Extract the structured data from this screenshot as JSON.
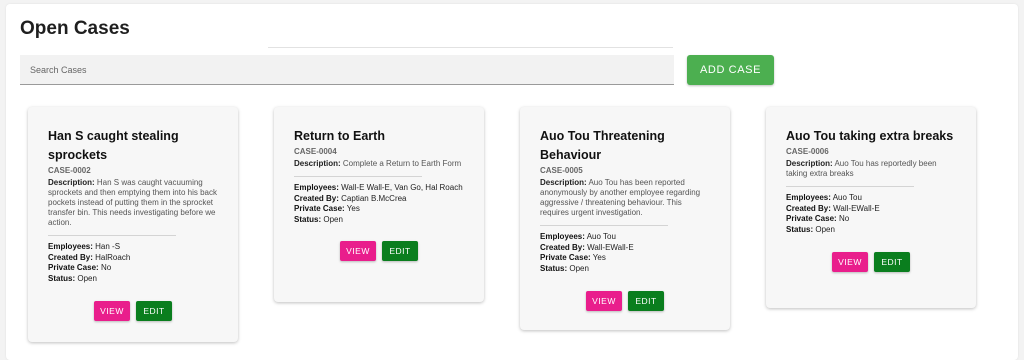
{
  "page": {
    "title": "Open Cases"
  },
  "search": {
    "placeholder": "Search Cases",
    "value": ""
  },
  "add_case_label": "ADD CASE",
  "labels": {
    "description": "Description:",
    "employees": "Employees:",
    "created_by": "Created By:",
    "private_case": "Private Case:",
    "status": "Status:"
  },
  "cases": [
    {
      "title": "Han S caught stealing sprockets",
      "id": "CASE-0002",
      "description": "Han S was caught vacuuming sprockets and then emptying them into his back pockets instead of putting them in the sprocket transfer bin. This needs investigating before we action.",
      "employees": "Han -S",
      "created_by": "HalRoach",
      "private_case": "No",
      "status": "Open",
      "view_label": "VIEW",
      "edit_label": "EDIT"
    },
    {
      "title": "Return to Earth",
      "id": "CASE-0004",
      "description": "Complete a Return to Earth Form",
      "employees": "Wall-E Wall-E, Van Go, Hal Roach",
      "created_by": "Captian B.McCrea",
      "private_case": "Yes",
      "status": "Open",
      "view_label": "VIEW",
      "edit_label": "EDIT"
    },
    {
      "title": "Auo Tou Threatening Behaviour",
      "id": "CASE-0005",
      "description": "Auo Tou has been reported anonymously by another employee regarding aggressive / threatening behaviour. This requires urgent investigation.",
      "employees": "Auo Tou",
      "created_by": "Wall-EWall-E",
      "private_case": "Yes",
      "status": "Open",
      "view_label": "VIEW",
      "edit_label": "EDIT"
    },
    {
      "title": "Auo Tou taking extra breaks",
      "id": "CASE-0006",
      "description": "Auo Tou has reportedly been taking extra breaks",
      "employees": "Auo Tou",
      "created_by": "Wall-EWall-E",
      "private_case": "No",
      "status": "Open",
      "view_label": "VIEW",
      "edit_label": "EDIT"
    }
  ]
}
